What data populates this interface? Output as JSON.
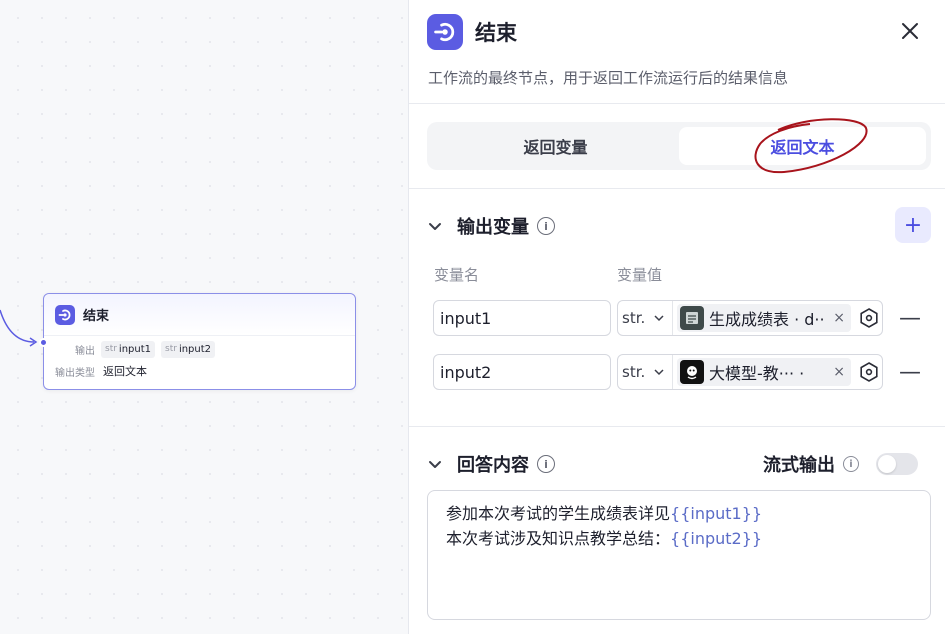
{
  "canvas": {
    "node": {
      "title": "结束",
      "output_label": "输出",
      "outputs": [
        {
          "type": "str",
          "name": "input1"
        },
        {
          "type": "str",
          "name": "input2"
        }
      ],
      "output_type_label": "输出类型",
      "output_type_value": "返回文本"
    }
  },
  "panel": {
    "title": "结束",
    "description": "工作流的最终节点，用于返回工作流运行后的结果信息",
    "tabs": [
      {
        "label": "返回变量",
        "active": false
      },
      {
        "label": "返回文本",
        "active": true
      }
    ],
    "output_section": {
      "title": "输出变量",
      "info": "i",
      "add_label": "+",
      "col_name": "变量名",
      "col_value": "变量值",
      "rows": [
        {
          "name": "input1",
          "type": "str.",
          "ref": "生成成绩表 · d··",
          "remove": "×",
          "delete": "—"
        },
        {
          "name": "input2",
          "type": "str.",
          "ref": "大模型-教···  ·",
          "remove": "×",
          "delete": "—"
        }
      ]
    },
    "answer_section": {
      "title": "回答内容",
      "info": "i",
      "stream_label": "流式输出",
      "stream_enabled": false,
      "lines": [
        {
          "text": "参加本次考试的学生成绩表详见",
          "var": "{{input1}}"
        },
        {
          "text": "本次考试涉及知识点教学总结：",
          "var": "{{input2}}"
        }
      ]
    }
  },
  "colors": {
    "accent": "#5b5ce2",
    "annotation": "#a8141c"
  }
}
